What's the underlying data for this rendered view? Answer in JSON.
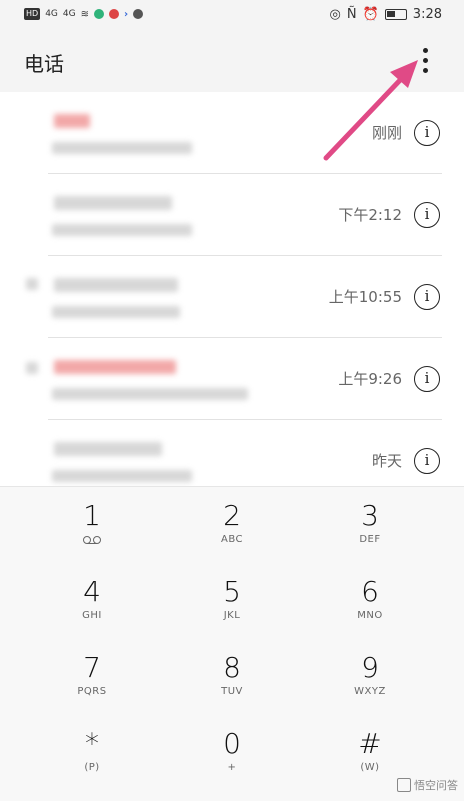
{
  "status_bar": {
    "left_text": "HD",
    "sig1": "4G",
    "sig2": "4G",
    "time": "3:28"
  },
  "header": {
    "title": "电话"
  },
  "calls": [
    {
      "time": "刚刚"
    },
    {
      "time": "下午2:12"
    },
    {
      "time": "上午10:55"
    },
    {
      "time": "上午9:26"
    },
    {
      "time": "昨天"
    }
  ],
  "info_glyph": "i",
  "dialpad": {
    "keys": [
      {
        "digit": "1",
        "letters": ""
      },
      {
        "digit": "2",
        "letters": "ABC"
      },
      {
        "digit": "3",
        "letters": "DEF"
      },
      {
        "digit": "4",
        "letters": "GHI"
      },
      {
        "digit": "5",
        "letters": "JKL"
      },
      {
        "digit": "6",
        "letters": "MNO"
      },
      {
        "digit": "7",
        "letters": "PQRS"
      },
      {
        "digit": "8",
        "letters": "TUV"
      },
      {
        "digit": "9",
        "letters": "WXYZ"
      },
      {
        "digit": "*",
        "letters": "(P)"
      },
      {
        "digit": "0",
        "letters": "+"
      },
      {
        "digit": "#",
        "letters": "(W)"
      }
    ]
  },
  "watermark": {
    "text": "悟空问答"
  },
  "colors": {
    "accent_arrow": "#e04a86",
    "header_bg": "#f4f4f4"
  }
}
